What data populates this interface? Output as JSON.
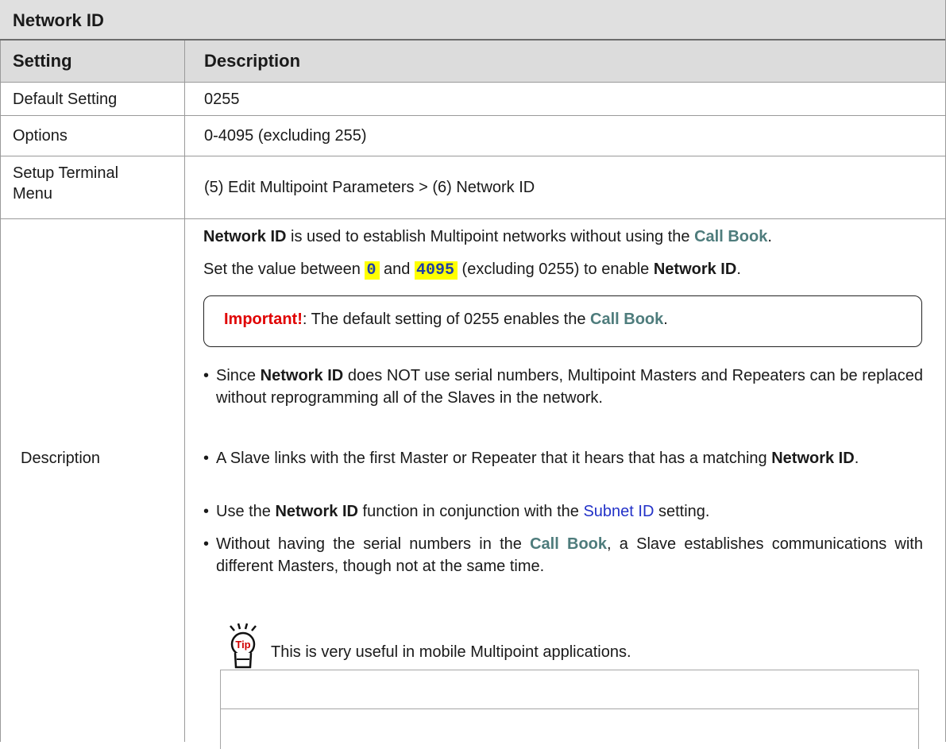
{
  "title": "Network ID",
  "header": {
    "setting": "Setting",
    "description": "Description"
  },
  "rows": {
    "default": {
      "label": "Default Setting",
      "value": "0255"
    },
    "options": {
      "label": "Options",
      "value": "0-4095 (excluding 255)"
    },
    "menu": {
      "label_line1": "Setup Terminal",
      "label_line2": "Menu",
      "value": "(5) Edit Multipoint Parameters > (6) Network ID"
    },
    "description": {
      "label": "Description"
    }
  },
  "description": {
    "para1": {
      "bold": "Network ID",
      "text": " is used to establish Multipoint networks without using the ",
      "callbook": "Call Book",
      "end": "."
    },
    "para2": {
      "pre": "Set the value between ",
      "code1": "0",
      "mid": " and ",
      "code2": "4095",
      "post": " (excluding 0255) to enable ",
      "bold": "Network ID",
      "end": "."
    },
    "important": {
      "label": "Important!",
      "text": ": The default setting of 0255 enables the ",
      "callbook": "Call Book",
      "end": "."
    },
    "bullet1": {
      "pre": "Since ",
      "bold": "Network ID",
      "post": " does NOT use serial numbers, Multipoint Masters and Repeaters can be replaced without reprogramming all of the Slaves in the network."
    },
    "bullet2": {
      "pre": "A Slave links with the first Master or Repeater that it hears that has a matching ",
      "bold": "Network ID",
      "end": "."
    },
    "bullet3": {
      "pre": "Use the ",
      "bold": "Network ID",
      "mid": " function in conjunction with the ",
      "link": "Subnet ID",
      "post": "  setting."
    },
    "bullet4": {
      "pre": "Without having the serial numbers in the ",
      "callbook": "Call Book",
      "post": ", a Slave establishes communications with different Masters, though not at the same time."
    },
    "tip": {
      "icon_letters": "Tip",
      "text": "This is very useful in mobile Multipoint applications."
    }
  }
}
